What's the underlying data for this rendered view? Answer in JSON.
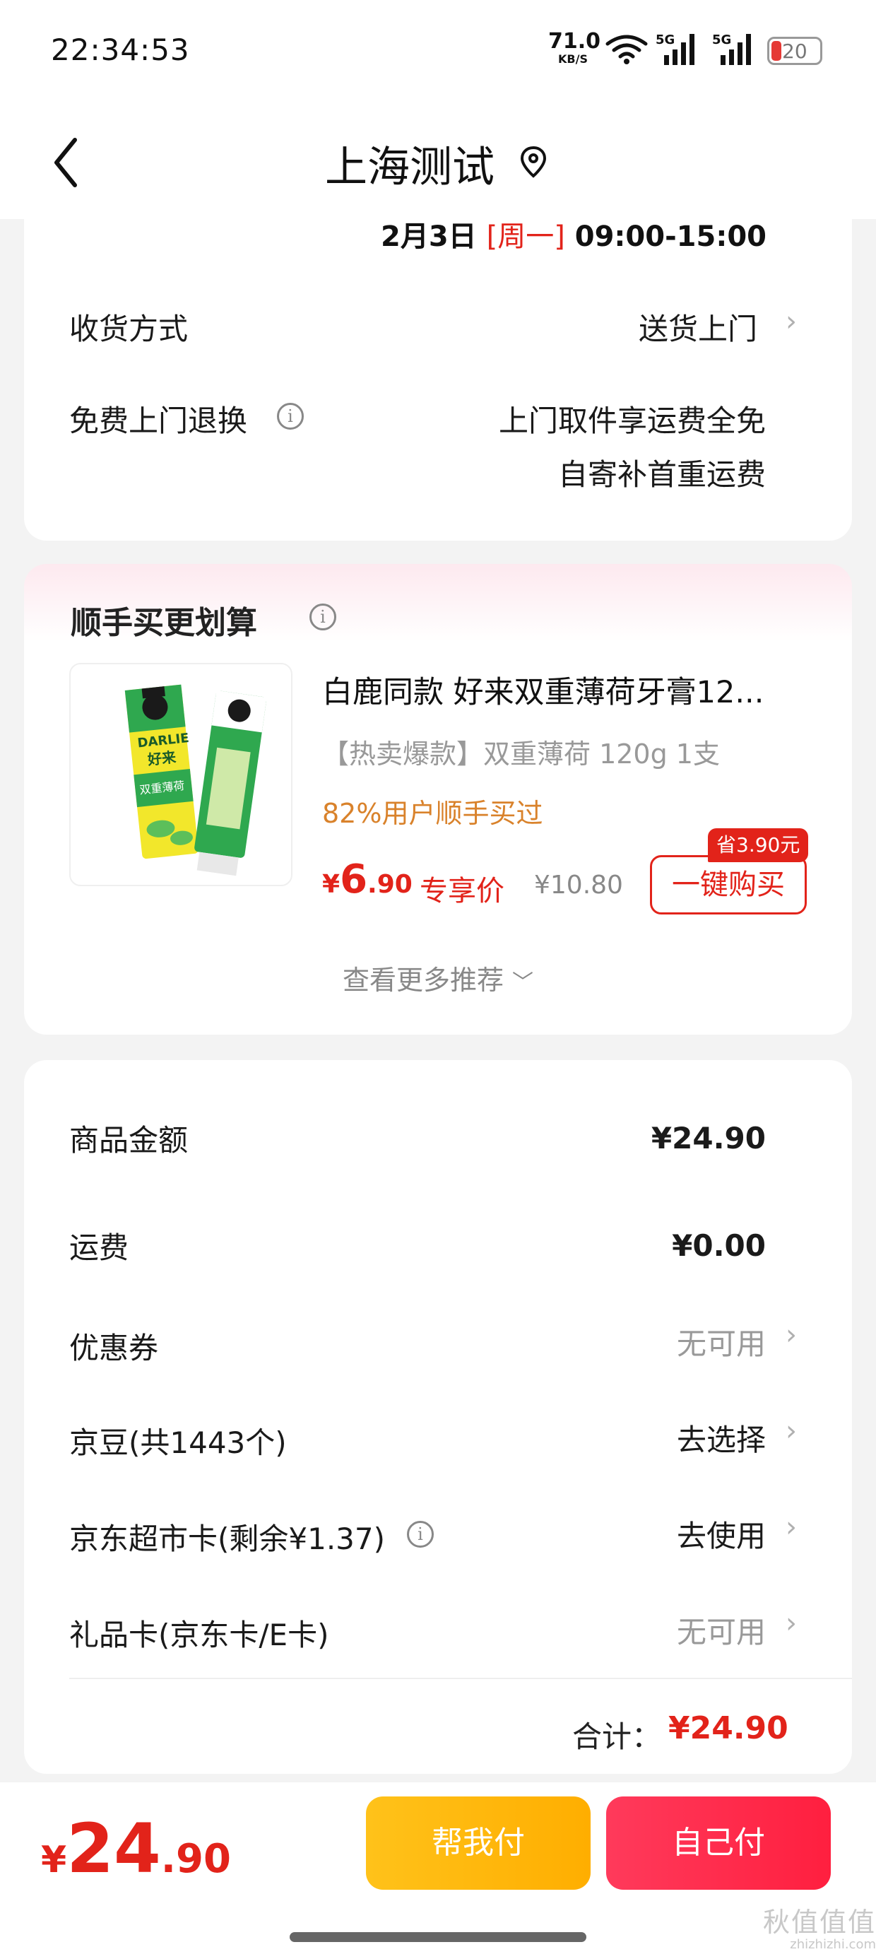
{
  "status_bar": {
    "time": "22:34:53",
    "net_speed": "71.0",
    "net_unit": "KB/S",
    "sig1": "5G",
    "sig2": "5G",
    "battery": "20"
  },
  "header": {
    "title": "上海测试"
  },
  "delivery": {
    "date": "2月3日",
    "weekday": "[周一]",
    "time_range": "09:00-15:00",
    "method_label": "收货方式",
    "method_value": "送货上门",
    "return_label": "免费上门退换",
    "return_line1": "上门取件享运费全免",
    "return_line2": "自寄补首重运费"
  },
  "recommend": {
    "title": "顺手买更划算",
    "product": {
      "title": "白鹿同款 好来双重薄荷牙膏12...",
      "spec": "【热卖爆款】双重薄荷 120g 1支",
      "bought": "82%用户顺手买过",
      "price_symbol": "¥",
      "price_int": "6",
      "price_dec": ".90",
      "exclusive": "专享价",
      "original_price": "¥10.80",
      "save_badge": "省3.90元",
      "buy_label": "一键购买",
      "image_brand": "DARLIE",
      "image_cn": "好来",
      "image_flavor": "双重薄荷"
    },
    "more_label": "查看更多推荐"
  },
  "summary": {
    "rows": [
      {
        "label": "商品金额",
        "value": "¥24.90"
      },
      {
        "label": "运费",
        "value": "¥0.00"
      },
      {
        "label": "优惠券",
        "value": "无可用"
      },
      {
        "label": "京豆(共1443个)",
        "value": "去选择"
      },
      {
        "label": "京东超市卡(剩余¥1.37)",
        "value": "去使用"
      },
      {
        "label": "礼品卡(京东卡/E卡)",
        "value": "无可用"
      }
    ],
    "total_label": "合计：",
    "total_value": "¥24.90"
  },
  "bottom": {
    "price_symbol": "¥",
    "price_int": "24",
    "price_dec": ".90",
    "help_pay": "帮我付",
    "self_pay": "自己付"
  },
  "watermark": {
    "main": "秋值值值",
    "url": "zhizhizhi.com"
  },
  "colors": {
    "accent_red": "#e2231a",
    "help_yellow": "#ffb800",
    "self_red": "#ff2a4a",
    "bought_orange": "#d9822b"
  }
}
